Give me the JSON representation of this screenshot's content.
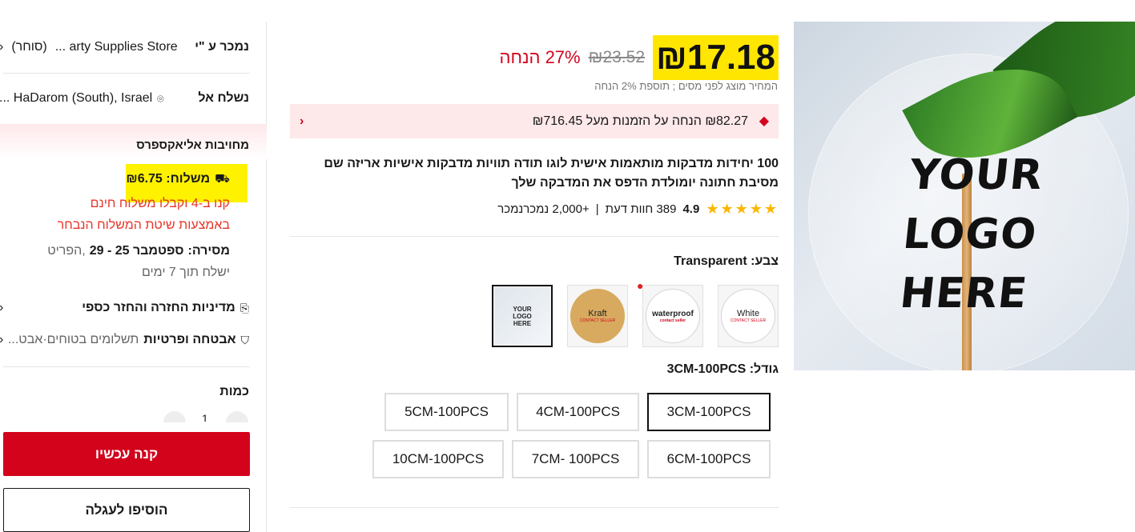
{
  "price": {
    "current": "₪17.18",
    "original": "₪23.52",
    "discount": "27% הנחה",
    "tax_note": "המחיר מוצג לפני מסים ; תוספת 2% הנחה"
  },
  "coupon": {
    "text": "₪82.27 הנחה על הזמנות מעל ₪716.45",
    "icon": "tag-icon"
  },
  "product": {
    "title": "100 יחידות מדבקות מותאמות אישית לוגו תודה תוויות מדבקות אישיות אריזה שם מסיבת חתונה יומולדת הדפס את המדבקה שלך",
    "rating": "4.9",
    "reviews": "389 חוות דעת",
    "sold": "+2,000 נמכרנמכר",
    "image_text_line1": "YOUR LOGO",
    "image_text_line2": "HERE"
  },
  "color": {
    "label": "צבע: Transparent",
    "options": [
      {
        "main": "White",
        "sub": "CONTACT SELLER"
      },
      {
        "main": "waterproof",
        "sub": "contact seller"
      },
      {
        "main": "Kraft",
        "sub": "CONTACT SELLER"
      },
      {
        "main": "YOUR LOGO HERE",
        "sub": ""
      }
    ]
  },
  "size": {
    "label": "גודל: 3CM-100PCS",
    "options": [
      "3CM-100PCS",
      "4CM-100PCS",
      "5CM-100PCS",
      "6CM-100PCS",
      "7CM- 100PCS",
      "10CM-100PCS"
    ],
    "selected": "3CM-100PCS"
  },
  "sidebar": {
    "sold_by_label": "נמכר ע \"י",
    "store_name": "arty Supplies Store ...",
    "follow": "(סוחר)",
    "ship_to_label": "נשלח אל",
    "ship_to_value": "HaDarom (South), Israel ...",
    "commitment": "מחויבות אליאקספרס",
    "shipping": "משלוח: ₪6.75",
    "free_ship_line1": "קנו ב-4 וקבלו משלוח חינם",
    "free_ship_line2": "באמצעות שיטת המשלוח הנבחר",
    "delivery_label": "מסירה:",
    "delivery_dates": "ספטמבר 25 - 29",
    "delivery_suffix": ",הפריט",
    "ships_within": "ישלח תוך 7 ימים",
    "return_policy": "מדיניות החזרה והחזר כספי",
    "security_label": "אבטחה ופרטיות",
    "security_desc": "תשלומים בטוחים·אבט...",
    "quantity_label": "כמות",
    "quantity_value": "1",
    "buy_now": "קנה עכשיו",
    "add_to_cart": "הוסיפו לעגלה"
  }
}
